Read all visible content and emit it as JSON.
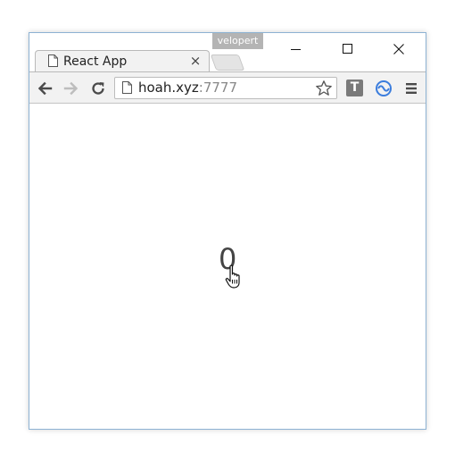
{
  "window": {
    "profile_name": "velopert"
  },
  "tab": {
    "title": "React App",
    "close_glyph": "×"
  },
  "toolbar": {
    "url_host": "hoah.xyz",
    "url_port": ":7777",
    "extension_t_label": "T"
  },
  "content": {
    "counter_value": "0"
  },
  "icons": {
    "back": "arrow-left-icon",
    "forward": "arrow-right-icon",
    "reload": "reload-icon",
    "bookmark": "star-icon",
    "menu": "hamburger-menu-icon",
    "cursor": "hand-pointer-icon"
  },
  "colors": {
    "frame_border": "#8db2d3",
    "toolbar_bg": "#f2f2f2",
    "profile_badge": "#b4b4b4",
    "extension_blue": "#3b7ddd"
  }
}
